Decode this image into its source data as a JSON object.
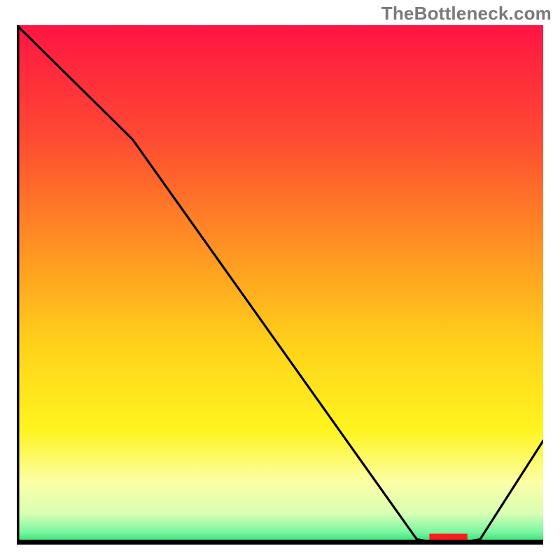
{
  "attribution": "TheBottleneck.com",
  "chart_data": {
    "type": "line",
    "title": "",
    "xlabel": "",
    "ylabel": "",
    "xlim": [
      0,
      100
    ],
    "ylim": [
      0,
      100
    ],
    "x": [
      0,
      22,
      76,
      82,
      88,
      100
    ],
    "values": [
      100,
      78,
      1,
      0,
      1,
      20
    ],
    "valley_x_range": [
      76,
      88
    ],
    "gradient_stops": [
      {
        "offset": 0.0,
        "color": "#ff1443"
      },
      {
        "offset": 0.22,
        "color": "#ff4b32"
      },
      {
        "offset": 0.45,
        "color": "#ff9a21"
      },
      {
        "offset": 0.62,
        "color": "#ffd31a"
      },
      {
        "offset": 0.78,
        "color": "#fff41f"
      },
      {
        "offset": 0.88,
        "color": "#fcffa6"
      },
      {
        "offset": 0.94,
        "color": "#d8ffb4"
      },
      {
        "offset": 0.975,
        "color": "#7cf7a2"
      },
      {
        "offset": 1.0,
        "color": "#1fd867"
      }
    ],
    "valley_label_text": "██████████",
    "line_color": "#000000",
    "axis_color": "#000000"
  }
}
